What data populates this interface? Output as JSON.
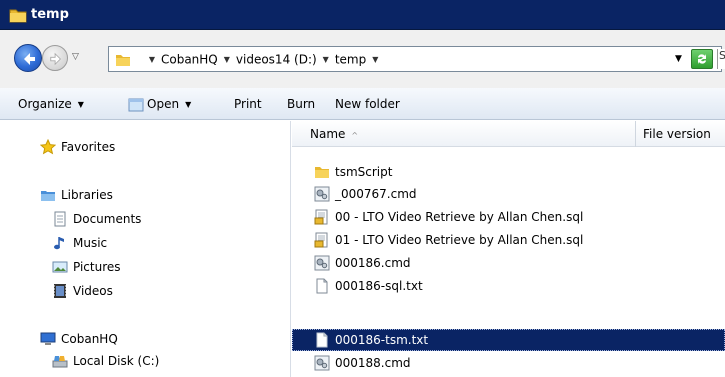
{
  "window": {
    "title": "temp"
  },
  "address": {
    "crumbs": [
      "CobanHQ",
      "videos14 (D:)",
      "temp"
    ],
    "search_stub": "S"
  },
  "toolbar": {
    "organize": "Organize",
    "open": "Open",
    "print": "Print",
    "burn": "Burn",
    "new_folder": "New folder"
  },
  "nav": {
    "favorites": "Favorites",
    "libraries": "Libraries",
    "library_items": [
      "Documents",
      "Music",
      "Pictures",
      "Videos"
    ],
    "computer": "CobanHQ",
    "local_disk": "Local Disk (C:)"
  },
  "columns": {
    "name": "Name",
    "file_version": "File version"
  },
  "files": [
    {
      "name": "tsmScript",
      "icon": "folder-icon"
    },
    {
      "name": "_000767.cmd",
      "icon": "cmd-file-icon"
    },
    {
      "name": "00 - LTO Video Retrieve by Allan Chen.sql",
      "icon": "sql-file-icon"
    },
    {
      "name": "01 - LTO Video Retrieve by Allan Chen.sql",
      "icon": "sql-file-icon"
    },
    {
      "name": "000186.cmd",
      "icon": "cmd-file-icon"
    },
    {
      "name": "000186-sql.txt",
      "icon": "text-file-icon"
    },
    {
      "name": "000186-tsm.txt",
      "icon": "text-file-icon",
      "selected": true
    },
    {
      "name": "000188.cmd",
      "icon": "cmd-file-icon"
    }
  ],
  "colors": {
    "titlebar": "#0a2464",
    "selection": "#0a2464",
    "toolbar_top": "#f6f9fd",
    "toolbar_bottom": "#dfe8f3"
  }
}
